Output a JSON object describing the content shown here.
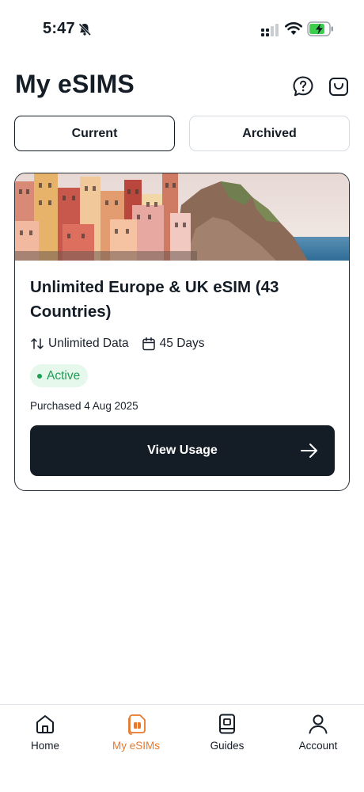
{
  "status_bar": {
    "time": "5:47"
  },
  "header": {
    "title": "My eSIMS"
  },
  "tabs": [
    {
      "label": "Current",
      "selected": true
    },
    {
      "label": "Archived",
      "selected": false
    }
  ],
  "card": {
    "title": "Unlimited Europe & UK eSIM (43 Countries)",
    "data_label": "Unlimited Data",
    "duration_label": "45 Days",
    "status": "Active",
    "purchased": "Purchased 4 Aug 2025",
    "button_label": "View Usage"
  },
  "colors": {
    "accent": "#e8782c",
    "primary_dark": "#141c26",
    "active_green": "#1f9d55",
    "active_bg": "#e6f7ec"
  },
  "bottom_nav": {
    "items": [
      {
        "label": "Home",
        "icon": "home-icon",
        "active": false
      },
      {
        "label": "My eSIMs",
        "icon": "esim-icon",
        "active": true
      },
      {
        "label": "Guides",
        "icon": "guide-book-icon",
        "active": false
      },
      {
        "label": "Account",
        "icon": "person-icon",
        "active": false
      }
    ]
  }
}
